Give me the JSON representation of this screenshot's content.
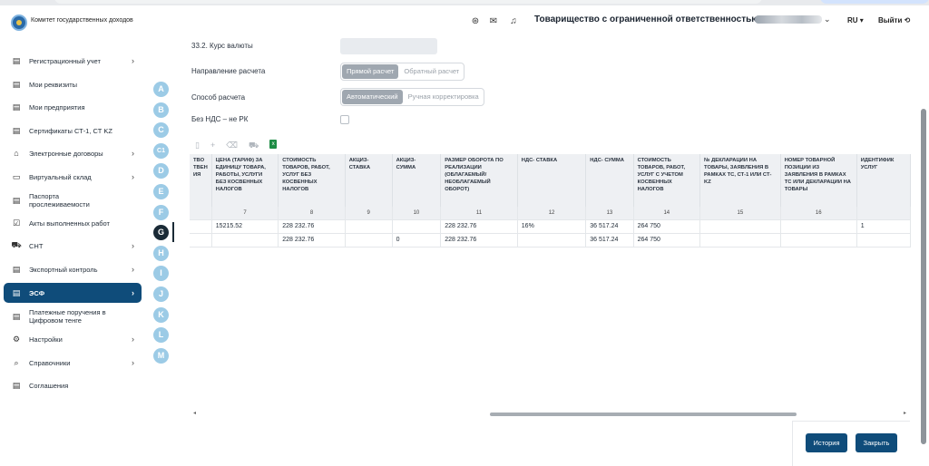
{
  "header": {
    "org_name": "Комитет государственных доходов",
    "company_name": "Товарищество с ограниченной ответственностью \"",
    "lang": "RU ▾",
    "exit_label": "Выйти ⟲"
  },
  "sidebar": {
    "items": [
      {
        "label": "Регистрационный учет",
        "icon": "document-icon",
        "glyph": "▤",
        "arrow": "›"
      },
      {
        "label": "Мои реквизиты",
        "icon": "document-icon",
        "glyph": "▤",
        "arrow": ""
      },
      {
        "label": "Мои предприятия",
        "icon": "document-icon",
        "glyph": "▤",
        "arrow": ""
      },
      {
        "label": "Сертификаты СТ-1, СТ KZ",
        "icon": "document-icon",
        "glyph": "▤",
        "arrow": ""
      },
      {
        "label": "Электронные договоры",
        "icon": "building-icon",
        "glyph": "⌂",
        "arrow": "›"
      },
      {
        "label": "Виртуальный склад",
        "icon": "folder-icon",
        "glyph": "▭",
        "arrow": "›"
      },
      {
        "label": "Паспорта прослеживаемости",
        "icon": "document-icon",
        "glyph": "▤",
        "arrow": ""
      },
      {
        "label": "Акты выполненных работ",
        "icon": "checkbox-icon",
        "glyph": "☑",
        "arrow": ""
      },
      {
        "label": "СНТ",
        "icon": "truck-icon",
        "glyph": "⛟",
        "arrow": "›"
      },
      {
        "label": "Экспортный контроль",
        "icon": "document-icon",
        "glyph": "▤",
        "arrow": "›"
      },
      {
        "label": "ЭСФ",
        "icon": "document-icon",
        "glyph": "▤",
        "arrow": "›"
      },
      {
        "label": "Платежные поручения в Цифровом тенге",
        "icon": "document-icon",
        "glyph": "▤",
        "arrow": ""
      },
      {
        "label": "Настройки",
        "icon": "gear-icon",
        "glyph": "⚙",
        "arrow": "›"
      },
      {
        "label": "Справочники",
        "icon": "search-book-icon",
        "glyph": "⌕",
        "arrow": "›"
      },
      {
        "label": "Соглашения",
        "icon": "document-icon",
        "glyph": "▤",
        "arrow": ""
      }
    ]
  },
  "sections": [
    "A",
    "B",
    "C",
    "C1",
    "D",
    "E",
    "F",
    "G",
    "H",
    "I",
    "J",
    "K",
    "L",
    "M"
  ],
  "form": {
    "rate_label": "33.2. Курс валюты",
    "direction_label": "Направление расчета",
    "direction_options": [
      "Прямой расчет",
      "Обратный расчет"
    ],
    "method_label": "Способ расчета",
    "method_options": [
      "Автоматический",
      "Ручная корректировка"
    ],
    "vat_label": "Без НДС – не РК"
  },
  "table": {
    "headers": [
      "ТВО ТВЕН ИЯ",
      "ЦЕНА (ТАРИФ) ЗА ЕДИНИЦУ ТОВАРА, РАБОТЫ, УСЛУГИ БЕЗ КОСВЕННЫХ НАЛОГОВ",
      "СТОИМОСТЬ ТОВАРОВ, РАБОТ, УСЛУГ БЕЗ КОСВЕННЫХ НАЛОГОВ",
      "АКЦИЗ- СТАВКА",
      "АКЦИЗ- СУММА",
      "РАЗМЕР ОБОРОТА ПО РЕАЛИЗАЦИИ (ОБЛАГАЕМЫЙ/ НЕОБЛАГАЕМЫЙ ОБОРОТ)",
      "НДС- СТАВКА",
      "НДС- СУММА",
      "СТОИМОСТЬ ТОВАРОВ, РАБОТ, УСЛУГ С УЧЕТОМ КОСВЕННЫХ НАЛОГОВ",
      "№ ДЕКЛАРАЦИИ НА ТОВАРЫ, ЗАЯВЛЕНИЯ В РАМКАХ ТС, СТ-1 ИЛИ СТ-KZ",
      "НОМЕР ТОВАРНОЙ ПОЗИЦИИ ИЗ ЗАЯВЛЕНИЯ В РАМКАХ ТС ИЛИ ДЕКЛАРАЦИИ НА ТОВАРЫ",
      "ИДЕНТИФИК УСЛУГ"
    ],
    "col_numbers": [
      "",
      "7",
      "8",
      "9",
      "10",
      "11",
      "12",
      "13",
      "14",
      "15",
      "16",
      ""
    ],
    "rows": [
      [
        "",
        "15215.52",
        "228 232.76",
        "",
        "",
        "228 232.76",
        "16%",
        "36 517.24",
        "264 750",
        "",
        "",
        "1"
      ],
      [
        "",
        "",
        "228 232.76",
        "",
        "0",
        "228 232.76",
        "",
        "36 517.24",
        "264 750",
        "",
        "",
        ""
      ]
    ]
  },
  "footer": {
    "history_button": "История",
    "close_button": "Закрыть"
  },
  "colors": {
    "primary": "#0f4c7a",
    "section_badge": "#9ccbe6"
  }
}
